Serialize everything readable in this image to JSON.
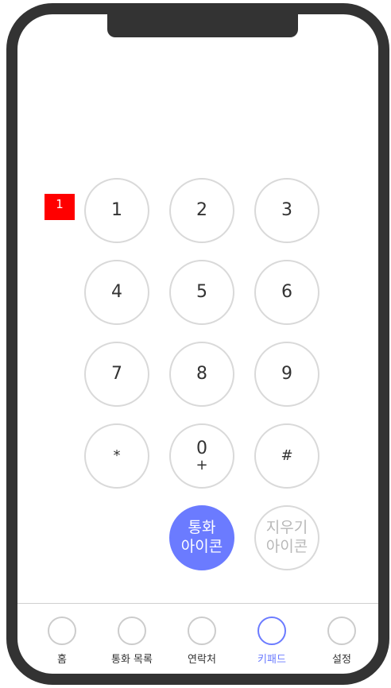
{
  "badge": {
    "label": "1"
  },
  "keypad": {
    "keys": [
      {
        "digit": "1",
        "sub": ""
      },
      {
        "digit": "2",
        "sub": ""
      },
      {
        "digit": "3",
        "sub": ""
      },
      {
        "digit": "4",
        "sub": ""
      },
      {
        "digit": "5",
        "sub": ""
      },
      {
        "digit": "6",
        "sub": ""
      },
      {
        "digit": "7",
        "sub": ""
      },
      {
        "digit": "8",
        "sub": ""
      },
      {
        "digit": "9",
        "sub": ""
      },
      {
        "digit": "*",
        "sub": ""
      },
      {
        "digit": "0",
        "sub": "+"
      },
      {
        "digit": "#",
        "sub": ""
      }
    ],
    "call_label_line1": "통화",
    "call_label_line2": "아이콘",
    "delete_label_line1": "지우기",
    "delete_label_line2": "아이콘"
  },
  "nav": {
    "items": [
      {
        "label": "홈",
        "active": false
      },
      {
        "label": "통화 목록",
        "active": false
      },
      {
        "label": "연락처",
        "active": false
      },
      {
        "label": "키패드",
        "active": true
      },
      {
        "label": "설정",
        "active": false
      }
    ]
  },
  "colors": {
    "accent": "#6b7bff",
    "frame": "#333333",
    "badge": "#ff0000",
    "key_border": "#d9d9d9"
  }
}
